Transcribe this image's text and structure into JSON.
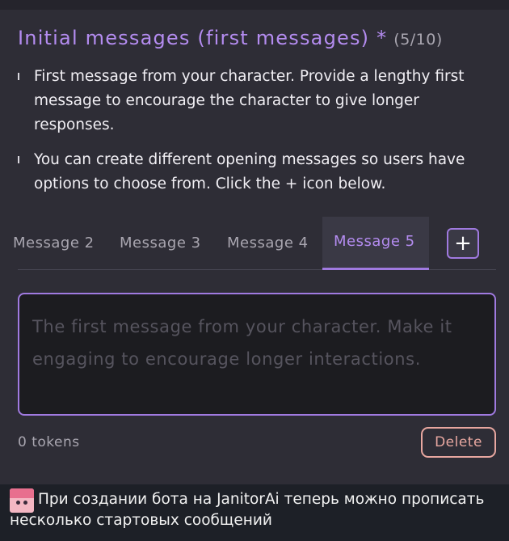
{
  "section": {
    "title": "Initial messages (first messages) *",
    "counter": "(5/10)",
    "bullets": [
      "First message from your character. Provide a lengthy first message to encourage the character to give longer responses.",
      "You can create different opening messages so users have options to choose from. Click the + icon below."
    ]
  },
  "tabs": {
    "items": [
      "Message 2",
      "Message 3",
      "Message 4",
      "Message 5"
    ],
    "active": "Message 5",
    "add_icon": "plus-icon",
    "add_symbol": "+"
  },
  "message_input": {
    "value": "",
    "placeholder": "The first message from your character. Make it engaging to encourage longer interactions."
  },
  "footer": {
    "tokens": "0 tokens",
    "delete_label": "Delete"
  },
  "caption": {
    "text": "При создании бота на JanitorAi теперь можно прописать несколько стартовых сообщений"
  },
  "colors": {
    "accent": "#b48cf0",
    "background": "#2e2d36",
    "input_bg": "#1c1c20",
    "danger": "#e8a7a0",
    "caption_bg": "#1d2027"
  }
}
